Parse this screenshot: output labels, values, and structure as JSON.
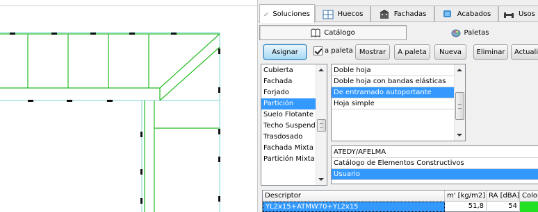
{
  "tabs": [
    {
      "label": "Soluciones",
      "icon": "pencil-icon",
      "active": true
    },
    {
      "label": "Huecos",
      "icon": "window-icon",
      "active": false
    },
    {
      "label": "Fachadas",
      "icon": "building-icon",
      "active": false
    },
    {
      "label": "Acabados",
      "icon": "paint-icon",
      "active": false
    },
    {
      "label": "Usos",
      "icon": "bed-icon",
      "active": false
    }
  ],
  "subtabs": {
    "catalogo": {
      "label": "Catálogo",
      "icon": "book-icon"
    },
    "paletas": {
      "label": "Paletas",
      "icon": "palette-icon"
    }
  },
  "toolbar": {
    "asignar": "Asignar",
    "a_paleta_check": "a paleta",
    "mostrar": "Mostrar",
    "a_paleta_button": "A paleta",
    "nueva": "Nueva",
    "eliminar": "Eliminar",
    "actualizar": "Actualiz"
  },
  "categories": {
    "items": [
      "Cubierta",
      "Fachada",
      "Forjado",
      "Partición",
      "Suelo Flotante",
      "Techo Suspendido",
      "Trasdosado",
      "Fachada Mixta",
      "Partición Mixta"
    ],
    "selected": "Partición"
  },
  "types": {
    "items": [
      "Doble hoja",
      "Doble hoja con bandas elásticas",
      "De entramado autoportante",
      "Hoja simple"
    ],
    "selected": "De entramado autoportante"
  },
  "catalogs": {
    "items": [
      "ATEDY/AFELMA",
      "Catálogo de Elementos Constructivos",
      "Usuario"
    ],
    "selected": "Usuario"
  },
  "grid": {
    "headers": {
      "descriptor": "Descriptor",
      "mass": "m' [kg/m2]",
      "ra": "RA [dBA]",
      "color": "Color"
    },
    "row": {
      "descriptor": "YL2x15+ATMW70+YL2x15",
      "mass": "51,8",
      "ra": "54",
      "color": "#22e022"
    }
  },
  "colors": {
    "selection": "#3399ff",
    "drawing_line": "#22bb22",
    "drawing_guide": "#7fd6d6",
    "tab_accent": "#3c7fb1"
  }
}
